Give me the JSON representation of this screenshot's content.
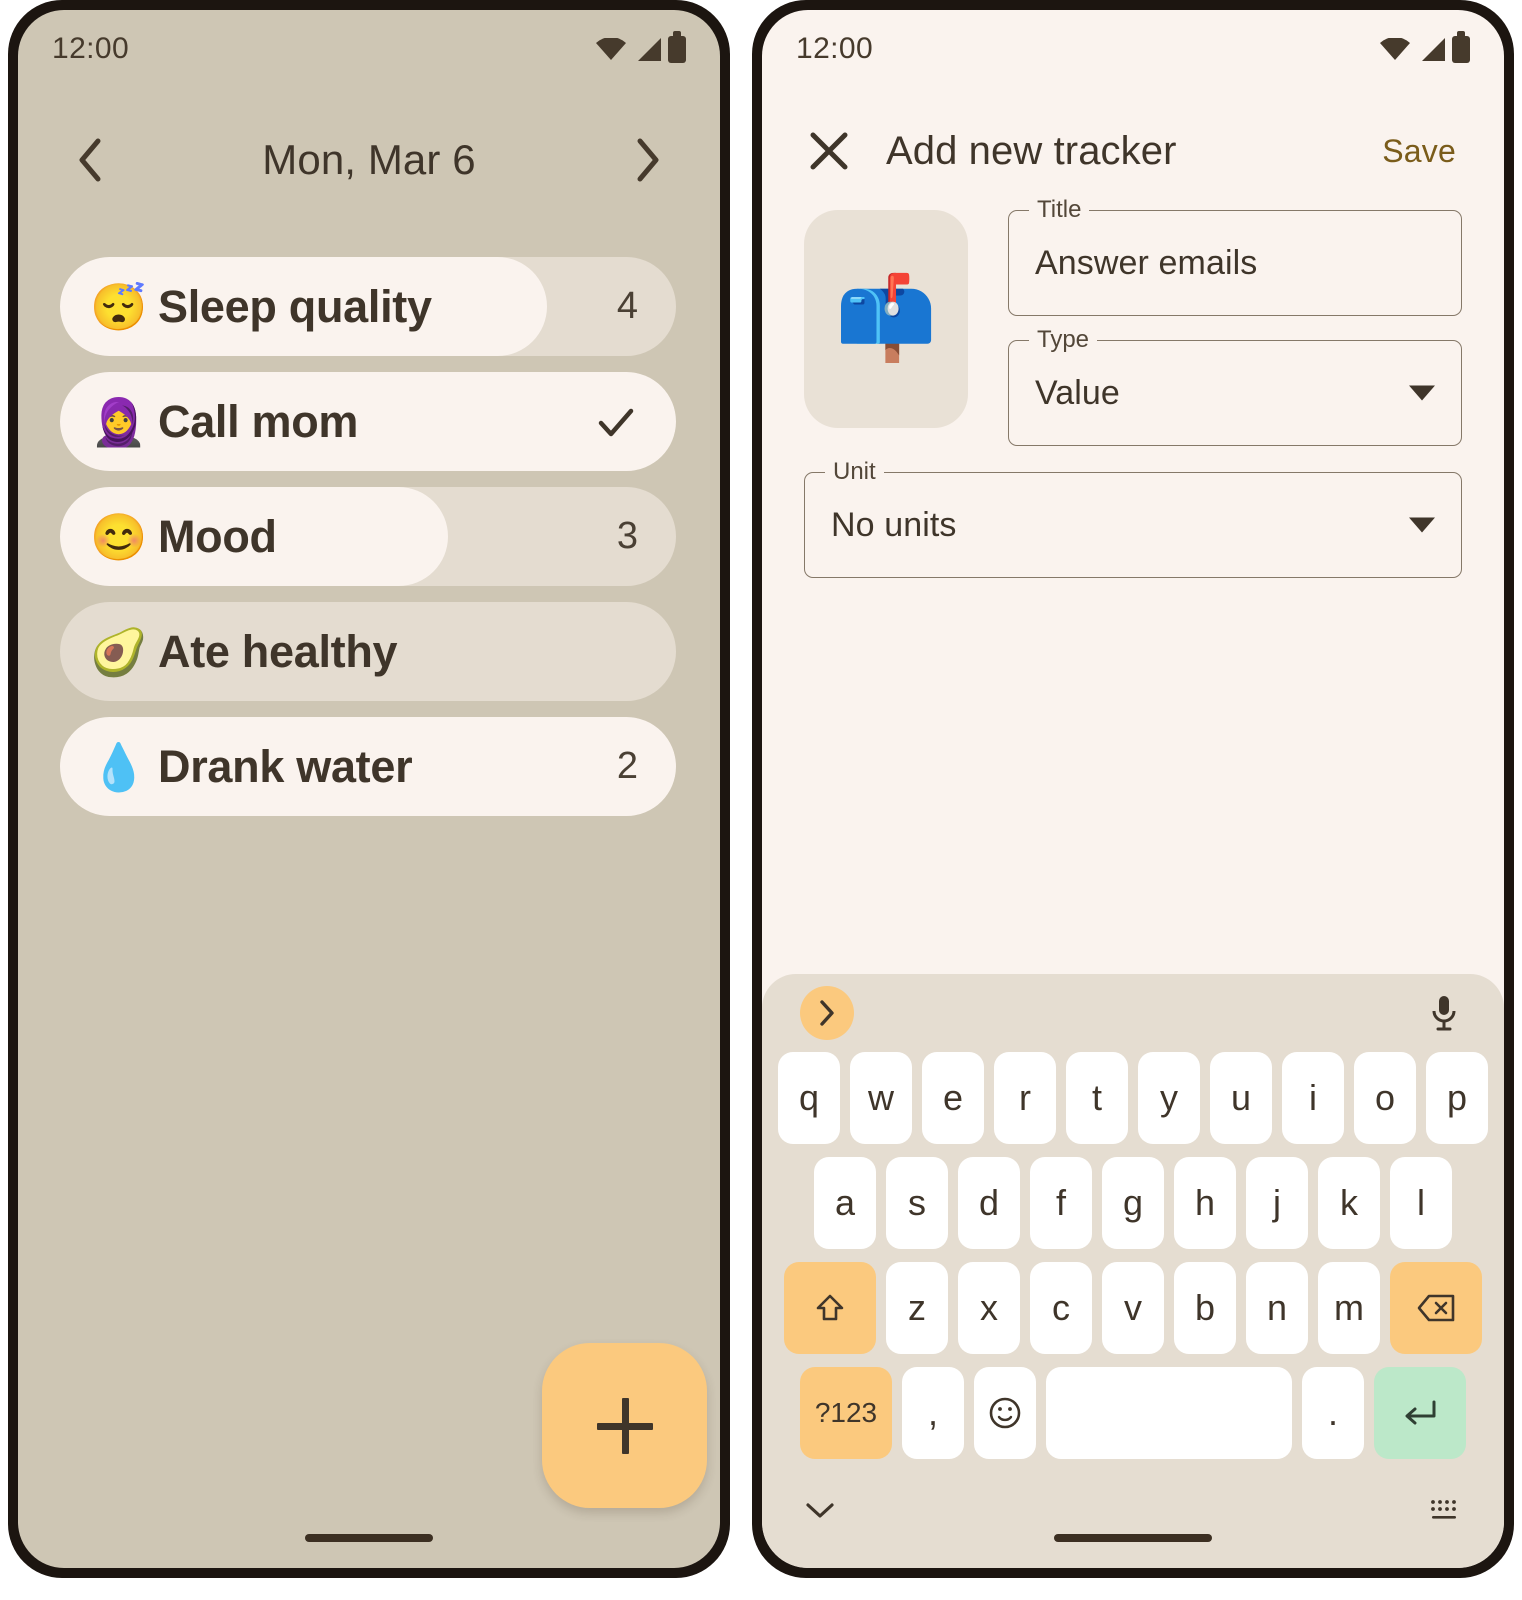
{
  "left_phone": {
    "status": {
      "time": "12:00",
      "icons": [
        "wifi-icon",
        "signal-icon",
        "battery-icon"
      ]
    },
    "header": {
      "prev_label": "chevron-left-icon",
      "date": "Mon, Mar 6",
      "next_label": "chevron-right-icon"
    },
    "trackers": [
      {
        "emoji": "😴",
        "emoji_name": "sleeping-face",
        "label": "Sleep quality",
        "value": "4",
        "progress": 79,
        "checked": false
      },
      {
        "emoji": "🧕",
        "emoji_name": "woman-with-headscarf",
        "label": "Call mom",
        "value": "",
        "progress": 100,
        "checked": true
      },
      {
        "emoji": "😊",
        "emoji_name": "smiling-face",
        "label": "Mood",
        "value": "3",
        "progress": 63,
        "checked": false
      },
      {
        "emoji": "🥑",
        "emoji_name": "avocado",
        "label": "Ate healthy",
        "value": "",
        "progress": 0,
        "checked": false
      },
      {
        "emoji": "💧",
        "emoji_name": "droplet",
        "label": "Drank water",
        "value": "2",
        "progress": 100,
        "checked": false
      }
    ],
    "fab": {
      "label": "+",
      "color": "#fbc97e"
    }
  },
  "right_phone": {
    "status": {
      "time": "12:00",
      "icons": [
        "wifi-icon",
        "signal-icon",
        "battery-icon"
      ]
    },
    "appbar": {
      "close_label": "close-icon",
      "title": "Add new tracker",
      "save_label": "Save",
      "save_color": "#7a5c1a"
    },
    "form": {
      "emoji": "📫",
      "emoji_name": "closed-mailbox-with-raised-flag",
      "fields": [
        {
          "label": "Title",
          "value": "Answer emails",
          "kind": "text"
        },
        {
          "label": "Type",
          "value": "Value",
          "kind": "select"
        },
        {
          "label": "Unit",
          "value": "No units",
          "kind": "select"
        }
      ]
    },
    "keyboard": {
      "expand_label": "chevron-right-icon",
      "mic_label": "microphone-icon",
      "row1": [
        "q",
        "w",
        "e",
        "r",
        "t",
        "y",
        "u",
        "i",
        "o",
        "p"
      ],
      "row2": [
        "a",
        "s",
        "d",
        "f",
        "g",
        "h",
        "j",
        "k",
        "l"
      ],
      "row3": [
        "z",
        "x",
        "c",
        "v",
        "b",
        "n",
        "m"
      ],
      "shift_label": "shift-icon",
      "backspace_label": "backspace-icon",
      "num_label": "?123",
      "comma_label": ",",
      "emoji_key_label": "emoji-icon",
      "space_label": "",
      "period_label": ".",
      "enter_label": "enter-icon",
      "hide_label": "chevron-down-icon",
      "switch_label": "keyboard-switch-icon"
    }
  }
}
